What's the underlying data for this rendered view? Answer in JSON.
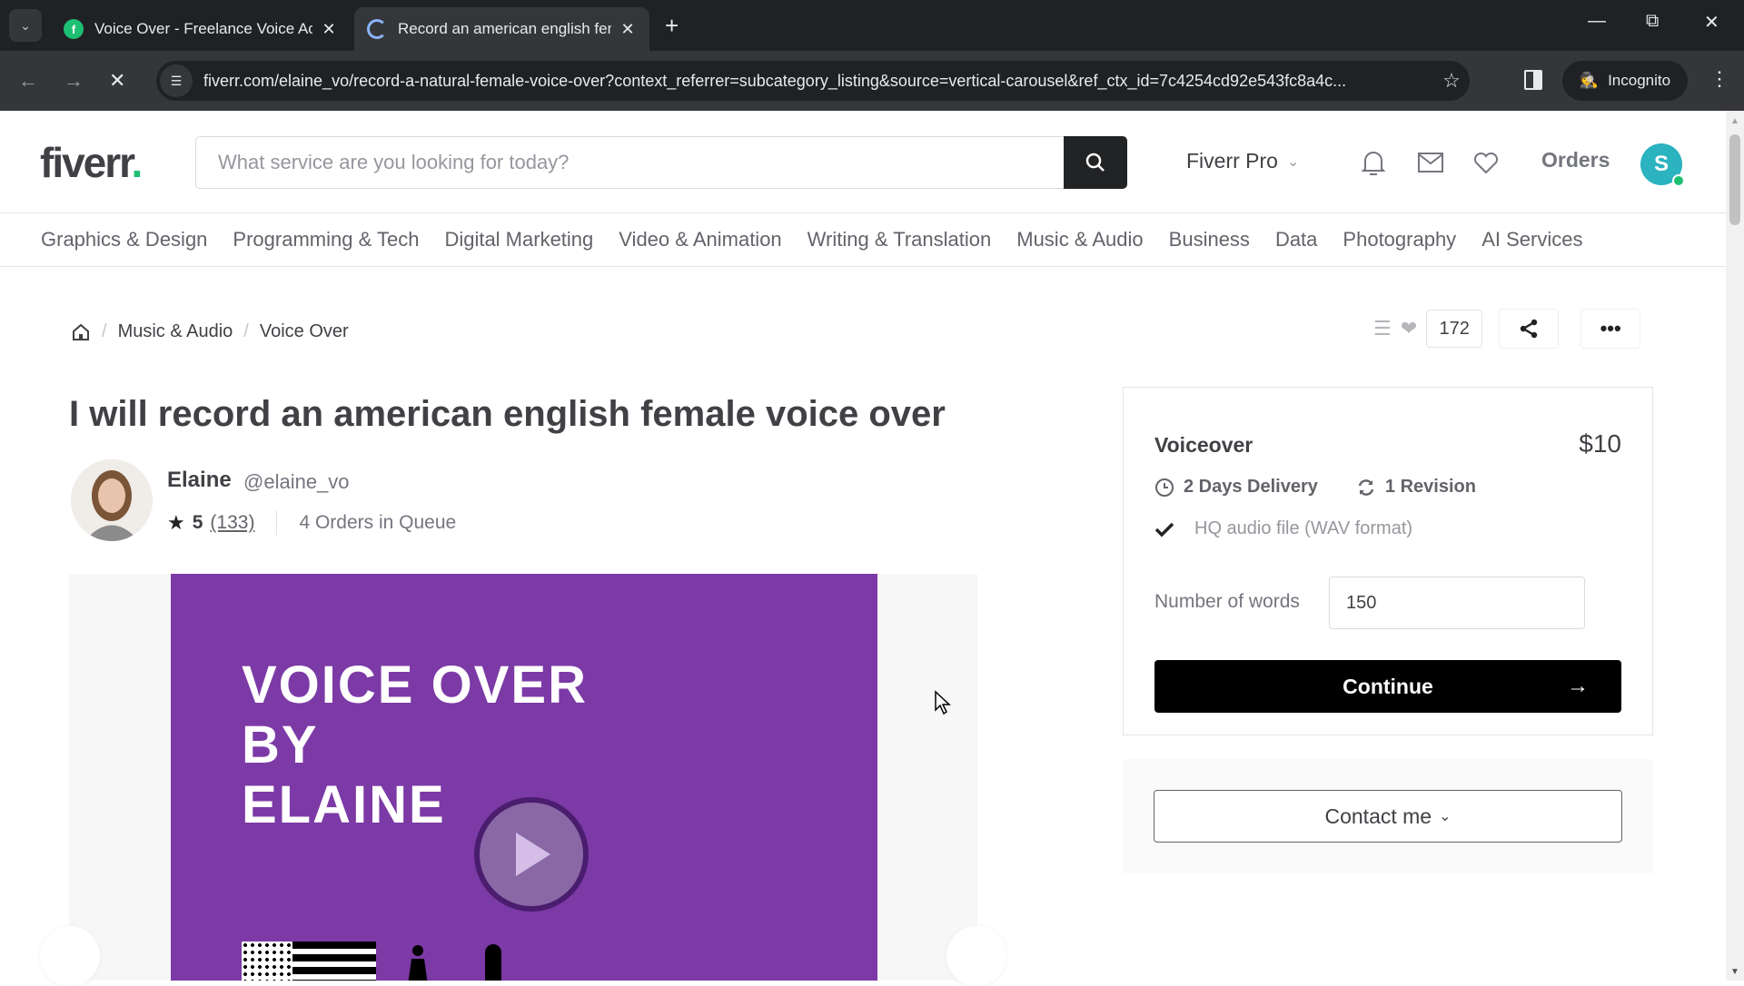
{
  "browser": {
    "tabs": [
      {
        "title": "Voice Over - Freelance Voice Ac",
        "favicon": "fiverr-favicon",
        "active": false
      },
      {
        "title": "Record an american english fem",
        "favicon": "loading-spinner",
        "active": true
      }
    ],
    "new_tab_label": "+",
    "url": "fiverr.com/elaine_vo/record-a-natural-female-voice-over?context_referrer=subcategory_listing&source=vertical-carousel&ref_ctx_id=7c4254cd92e543fc8a4c...",
    "incognito_label": "Incognito"
  },
  "header": {
    "logo": "fiverr",
    "logo_dot": ".",
    "search_placeholder": "What service are you looking for today?",
    "fiverr_pro_label": "Fiverr Pro",
    "orders_label": "Orders",
    "avatar_initial": "S",
    "brand_color": "#1dbf73"
  },
  "categories": [
    "Graphics & Design",
    "Programming & Tech",
    "Digital Marketing",
    "Video & Animation",
    "Writing & Translation",
    "Music & Audio",
    "Business",
    "Data",
    "Photography",
    "AI Services"
  ],
  "breadcrumb": [
    "Music & Audio",
    "Voice Over"
  ],
  "actions": {
    "save_count": "172"
  },
  "gig": {
    "title": "I will record an american english female voice over",
    "seller_name": "Elaine",
    "seller_handle": "@elaine_vo",
    "rating": "5",
    "reviews": "(133)",
    "queue": "4 Orders in Queue",
    "slide_lines": [
      "VOICE OVER",
      "BY",
      "ELAINE"
    ],
    "slide_color": "#7c3aa6"
  },
  "package": {
    "name": "Voiceover",
    "price": "$10",
    "delivery": "2 Days Delivery",
    "revisions": "1 Revision",
    "features": [
      "HQ audio file (WAV format)"
    ],
    "words_label": "Number of words",
    "words_value": "150",
    "continue_label": "Continue",
    "contact_label": "Contact me"
  }
}
